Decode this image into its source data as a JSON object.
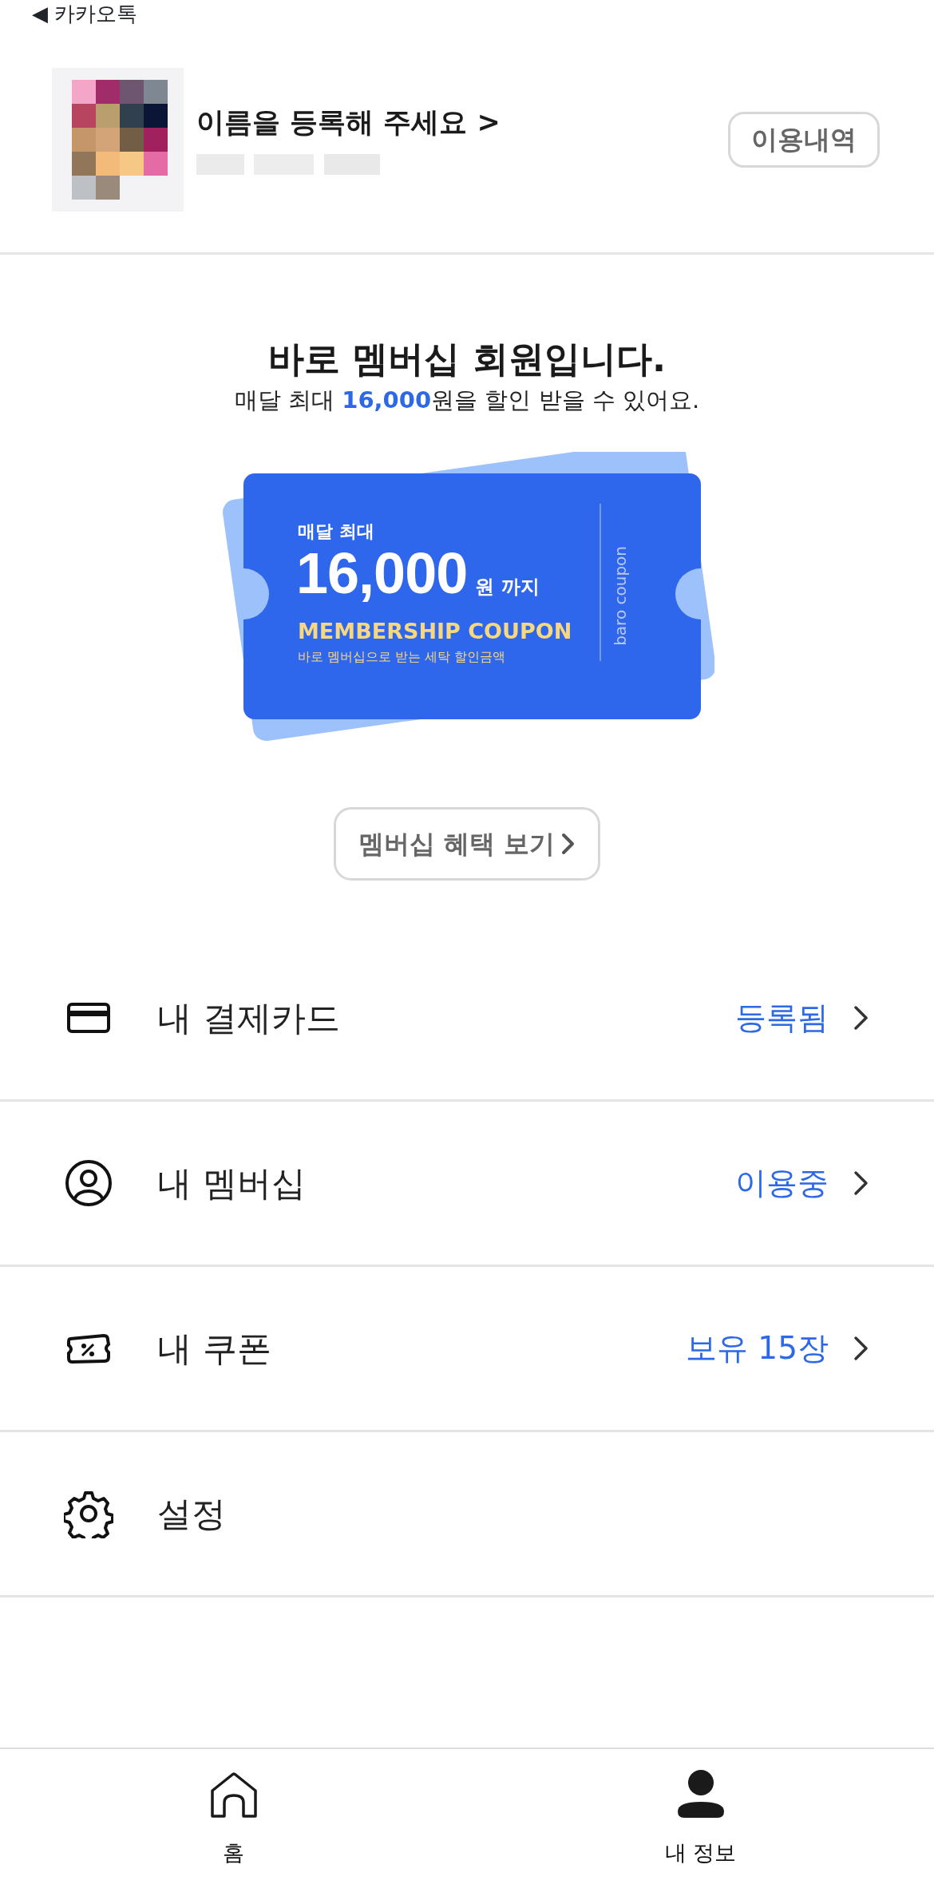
{
  "back_link": {
    "icon": "◀",
    "label": "카카오톡"
  },
  "profile": {
    "name_prompt": "이름을 등록해 주세요 >",
    "history_button": "이용내역"
  },
  "membership": {
    "title": "바로 멤버십 회원입니다.",
    "subtitle": "매달 최대 **16,000**원을 할인 받을 수 있어요.",
    "coupon": {
      "label": "매달 최대",
      "amount": "16,000",
      "unit": "원 까지",
      "title": "MEMBERSHIP COUPON",
      "caption": "바로 멤버십으로 받는 세탁 할인금액",
      "side_text": "baro coupon"
    },
    "benefits_button": "멤버십 혜택 보기"
  },
  "menu": [
    {
      "kind": "card",
      "label": "내 결제카드",
      "value": "등록됨"
    },
    {
      "kind": "membership",
      "label": "내 멤버십",
      "value": "이용중"
    },
    {
      "kind": "coupon",
      "label": "내 쿠폰",
      "value": "보유 15장"
    },
    {
      "kind": "settings",
      "label": "설정"
    }
  ],
  "bottom_nav": [
    {
      "kind": "home",
      "label": "홈",
      "selected": false
    },
    {
      "kind": "profile",
      "label": "내 정보",
      "selected": true
    }
  ]
}
